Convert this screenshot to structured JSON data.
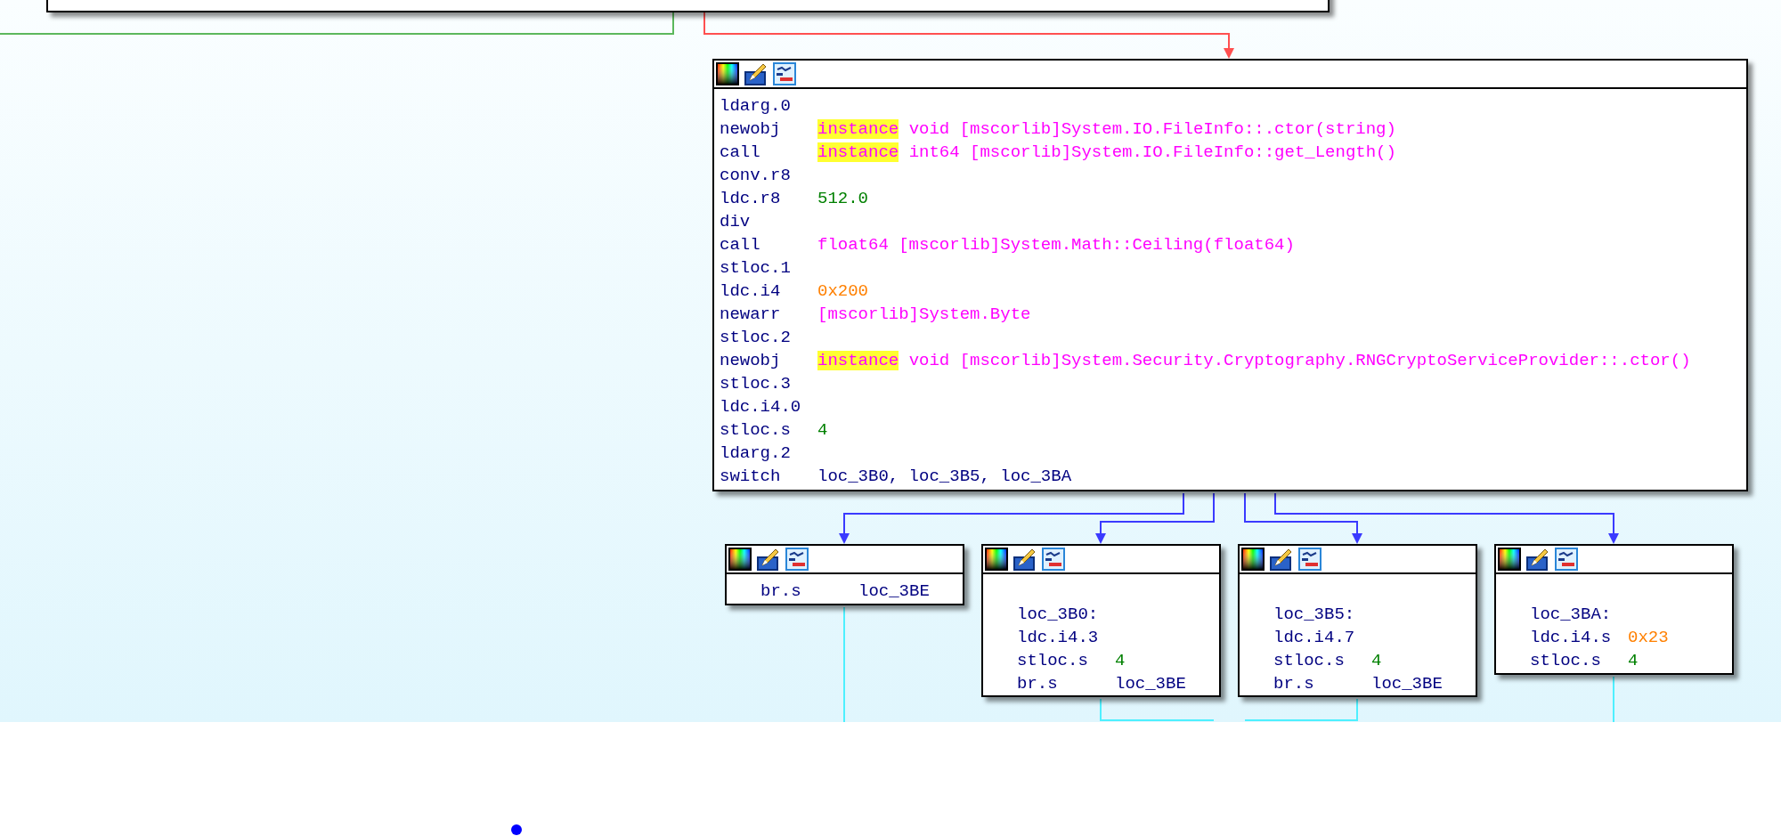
{
  "graph": {
    "blocks": [
      {
        "lines": [
          {
            "mnemonic": "ldarg.0"
          },
          {
            "mnemonic": "newobj",
            "operand": [
              {
                "kind": "keyword",
                "text": "instance"
              },
              {
                "kind": "name",
                "text": "void [mscorlib]System.IO.FileInfo::.ctor(string)"
              }
            ]
          },
          {
            "mnemonic": "call",
            "operand": [
              {
                "kind": "keyword",
                "text": "instance"
              },
              {
                "kind": "name",
                "text": "int64 [mscorlib]System.IO.FileInfo::get_Length()"
              }
            ]
          },
          {
            "mnemonic": "conv.r8"
          },
          {
            "mnemonic": "ldc.r8",
            "operand": [
              {
                "kind": "number",
                "text": "512.0"
              }
            ]
          },
          {
            "mnemonic": "div"
          },
          {
            "mnemonic": "call",
            "operand": [
              {
                "kind": "name",
                "text": "float64 [mscorlib]System.Math::Ceiling(float64)"
              }
            ]
          },
          {
            "mnemonic": "stloc.1"
          },
          {
            "mnemonic": "ldc.i4",
            "operand": [
              {
                "kind": "hex",
                "text": "0x200"
              }
            ]
          },
          {
            "mnemonic": "newarr",
            "operand": [
              {
                "kind": "name",
                "text": "[mscorlib]System.Byte"
              }
            ]
          },
          {
            "mnemonic": "stloc.2"
          },
          {
            "mnemonic": "newobj",
            "operand": [
              {
                "kind": "keyword",
                "text": "instance"
              },
              {
                "kind": "name",
                "text": "void [mscorlib]System.Security.Cryptography.RNGCryptoServiceProvider::.ctor()"
              }
            ]
          },
          {
            "mnemonic": "stloc.3"
          },
          {
            "mnemonic": "ldc.i4.0"
          },
          {
            "mnemonic": "stloc.s",
            "operand": [
              {
                "kind": "number",
                "text": "4"
              }
            ]
          },
          {
            "mnemonic": "ldarg.2"
          },
          {
            "mnemonic": "switch",
            "operand": [
              {
                "kind": "label",
                "text": "loc_3B0, loc_3B5, loc_3BA"
              }
            ]
          }
        ]
      },
      {
        "lines": [
          {
            "mnemonic": "br.s",
            "operand": [
              {
                "kind": "label",
                "text": "loc_3BE"
              }
            ]
          }
        ]
      },
      {
        "lines": [
          {
            "label": "loc_3B0:"
          },
          {
            "mnemonic": "ldc.i4.3"
          },
          {
            "mnemonic": "stloc.s",
            "operand": [
              {
                "kind": "number",
                "text": "4"
              }
            ]
          },
          {
            "mnemonic": "br.s",
            "operand": [
              {
                "kind": "label",
                "text": "loc_3BE"
              }
            ]
          }
        ]
      },
      {
        "lines": [
          {
            "label": "loc_3B5:"
          },
          {
            "mnemonic": "ldc.i4.7"
          },
          {
            "mnemonic": "stloc.s",
            "operand": [
              {
                "kind": "number",
                "text": "4"
              }
            ]
          },
          {
            "mnemonic": "br.s",
            "operand": [
              {
                "kind": "label",
                "text": "loc_3BE"
              }
            ]
          }
        ]
      },
      {
        "lines": [
          {
            "label": "loc_3BA:"
          },
          {
            "mnemonic": "ldc.i4.s",
            "operand": [
              {
                "kind": "hex",
                "text": "0x23"
              }
            ]
          },
          {
            "mnemonic": "stloc.s",
            "operand": [
              {
                "kind": "number",
                "text": "4"
              }
            ]
          }
        ]
      }
    ]
  }
}
